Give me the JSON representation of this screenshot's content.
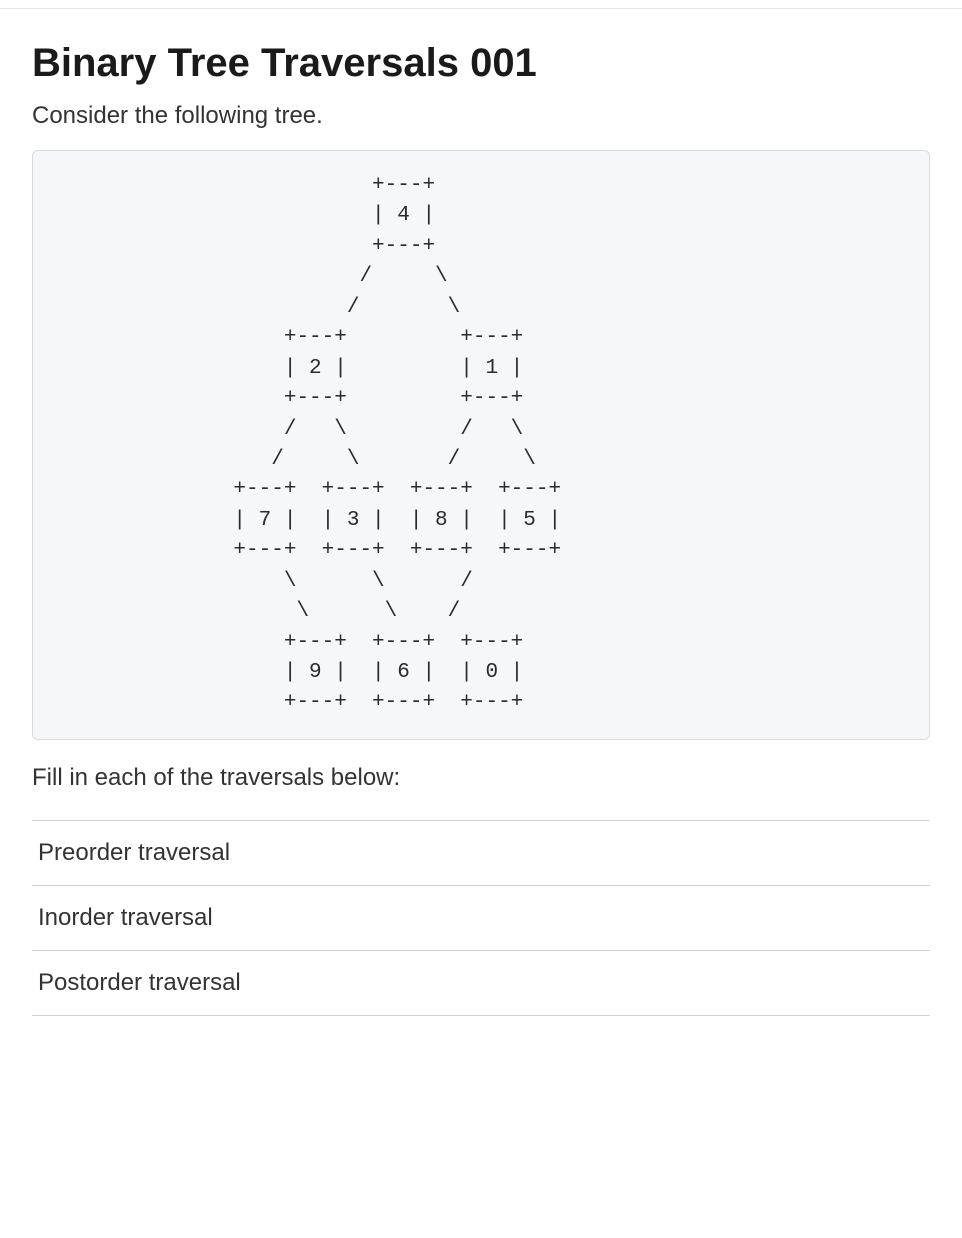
{
  "title": "Binary Tree Traversals 001",
  "intro": "Consider the following tree.",
  "tree_ascii": "                         +---+\n                         | 4 |\n                         +---+\n                        /     \\\n                       /       \\\n                  +---+         +---+\n                  | 2 |         | 1 |\n                  +---+         +---+\n                  /   \\         /   \\\n                 /     \\       /     \\\n              +---+  +---+  +---+  +---+\n              | 7 |  | 3 |  | 8 |  | 5 |\n              +---+  +---+  +---+  +---+\n                  \\      \\      /\n                   \\      \\    /\n                  +---+  +---+  +---+\n                  | 9 |  | 6 |  | 0 |\n                  +---+  +---+  +---+",
  "prompt": "Fill in each of the traversals below:",
  "traversals": {
    "preorder": "Preorder traversal",
    "inorder": "Inorder traversal",
    "postorder": "Postorder traversal"
  }
}
